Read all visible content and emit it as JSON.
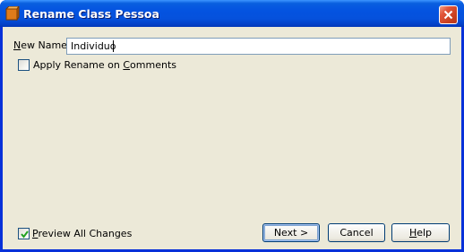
{
  "window": {
    "title": "Rename Class Pessoa",
    "close_icon": "close-icon",
    "app_icon": "class-icon"
  },
  "form": {
    "new_name_label": "New Name:",
    "new_name_mnemonic": "N",
    "new_name_label_rest": "ew Name:",
    "new_name_value": "Individuo",
    "apply_comments_label_pre": "Apply Rename on ",
    "apply_comments_mnemonic": "C",
    "apply_comments_label_post": "omments",
    "apply_comments_checked": false,
    "preview_mnemonic": "P",
    "preview_label_rest": "review All Changes",
    "preview_checked": true
  },
  "buttons": {
    "next_label": "Next >",
    "cancel_label": "Cancel",
    "help_mnemonic": "H",
    "help_label_rest": "elp"
  },
  "colors": {
    "title_bar": "#0453e0",
    "dialog_background": "#ece9d8",
    "close_button": "#c9401f"
  }
}
